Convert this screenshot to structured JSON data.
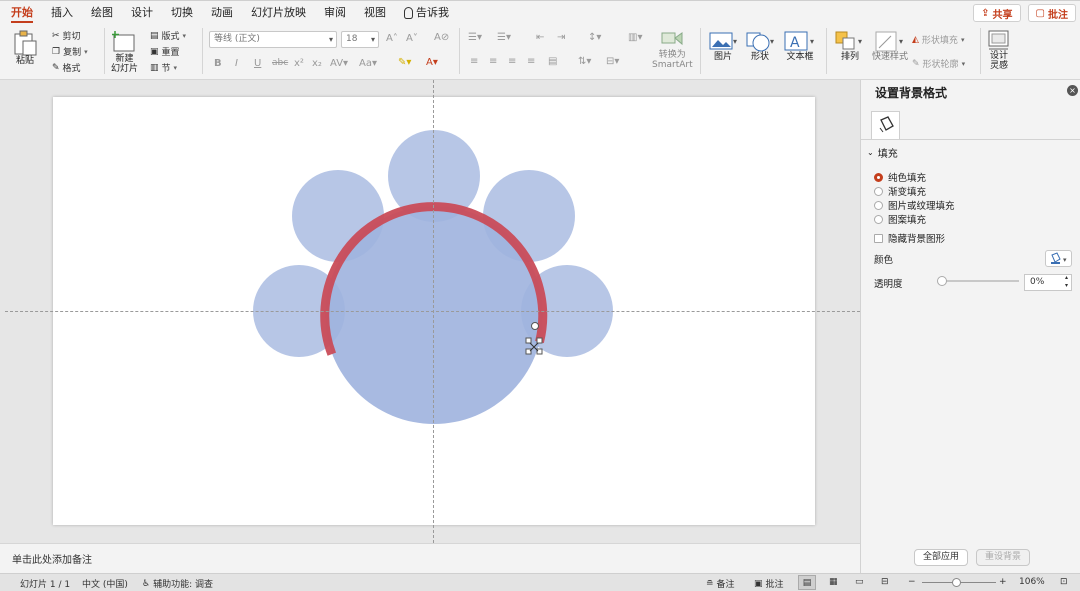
{
  "menu": {
    "tabs": [
      "开始",
      "插入",
      "绘图",
      "设计",
      "切换",
      "动画",
      "幻灯片放映",
      "审阅",
      "视图"
    ],
    "active_tab": "开始",
    "tell_me": "告诉我",
    "share": "共享",
    "comments": "批注"
  },
  "ribbon": {
    "paste": "粘贴",
    "cut": "剪切",
    "copy": "复制",
    "format": "格式",
    "new_slide_line1": "新建",
    "new_slide_line2": "幻灯片",
    "layout": "版式",
    "reset": "重置",
    "section": "节",
    "font_name": "等线 (正文)",
    "font_size": "18",
    "smartart_line1": "转换为",
    "smartart_line2": "SmartArt",
    "picture": "图片",
    "shape": "形状",
    "textbox": "文本框",
    "arrange": "排列",
    "quick_styles": "快速样式",
    "shape_fill": "形状填充",
    "shape_outline": "形状轮廓",
    "designer_line1": "设计",
    "designer_line2": "灵感"
  },
  "notes": {
    "placeholder": "单击此处添加备注"
  },
  "pane": {
    "title": "设置背景格式",
    "section_fill": "填充",
    "options": [
      {
        "label": "纯色填充",
        "selected": true
      },
      {
        "label": "渐变填充",
        "selected": false
      },
      {
        "label": "图片或纹理填充",
        "selected": false
      },
      {
        "label": "图案填充",
        "selected": false
      }
    ],
    "hide_bg": "隐藏背景图形",
    "color_label": "颜色",
    "transparency_label": "透明度",
    "transparency_value": "0%",
    "transparency": 0,
    "apply_all": "全部应用",
    "reset_bg": "重设背景"
  },
  "status": {
    "slide": "幻灯片 1 / 1",
    "language": "中文 (中国)",
    "accessibility": "辅助功能: 调查",
    "notes": "备注",
    "comments": "批注",
    "zoom": "106%"
  },
  "colors": {
    "accent": "#c43e1c",
    "circle": "#9fb3de",
    "arc": "#c94c58"
  }
}
